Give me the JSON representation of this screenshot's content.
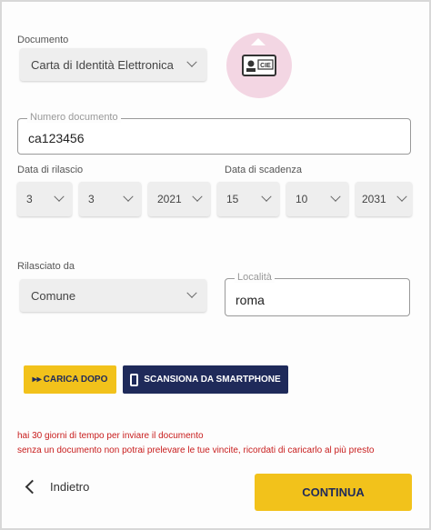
{
  "documento": {
    "label": "Documento",
    "selected": "Carta di Identità Elettronica",
    "badge_text": "CIE"
  },
  "numero_documento": {
    "label": "Numero documento",
    "value": "ca123456"
  },
  "data_rilascio": {
    "label": "Data di rilascio",
    "day": "3",
    "month": "3",
    "year": "2021"
  },
  "data_scadenza": {
    "label": "Data di scadenza",
    "day": "15",
    "month": "10",
    "year": "2031"
  },
  "rilasciato_da": {
    "label": "Rilasciato da",
    "selected": "Comune"
  },
  "localita": {
    "label": "Località",
    "value": "roma"
  },
  "actions": {
    "carica_dopo": "CARICA DOPO",
    "carica_dopo_icon": "▸▸",
    "scansiona": "SCANSIONA DA SMARTPHONE"
  },
  "warnings": {
    "line1": "hai 30 giorni di tempo per inviare il documento",
    "line2": "senza un documento non potrai prelevare le tue vincite, ricordati di caricarlo al più presto"
  },
  "footer": {
    "back_label": "Indietro",
    "continue_label": "CONTINUA"
  },
  "colors": {
    "accent_yellow": "#f2c21b",
    "navy": "#1f2a5a",
    "warning_red": "#c81d1d",
    "cie_circle": "#f3d6e3"
  }
}
